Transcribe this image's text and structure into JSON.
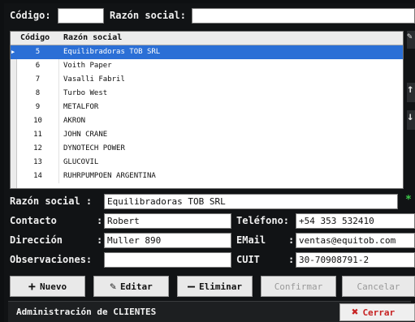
{
  "search": {
    "codigo_label": "Código:",
    "codigo_value": "",
    "razon_label": "Razón social:",
    "razon_value": ""
  },
  "grid": {
    "columns": [
      "Código",
      "Razón social"
    ],
    "rows": [
      {
        "code": "5",
        "name": "Equilibradoras TOB SRL",
        "selected": true
      },
      {
        "code": "6",
        "name": "Voith Paper"
      },
      {
        "code": "7",
        "name": "Vasalli Fabril"
      },
      {
        "code": "8",
        "name": "Turbo West"
      },
      {
        "code": "9",
        "name": "METALFOR"
      },
      {
        "code": "10",
        "name": "AKRON"
      },
      {
        "code": "11",
        "name": "JOHN CRANE"
      },
      {
        "code": "12",
        "name": "DYNOTECH POWER"
      },
      {
        "code": "13",
        "name": "GLUCOVIL"
      },
      {
        "code": "14",
        "name": "RUHRPUMPOEN ARGENTINA"
      }
    ]
  },
  "form": {
    "razon_label": "Razón social :",
    "razon_value": "Equilibradoras TOB SRL",
    "contacto_label": "Contacto",
    "contacto_value": "Robert",
    "telefono_label": "Teléfono:",
    "telefono_value": "+54 353 532410",
    "direccion_label": "Dirección",
    "direccion_value": "Muller 890",
    "email_label": "EMail",
    "email_value": "ventas@equitob.com",
    "obs_label": "Observaciones:",
    "obs_value": "",
    "cuit_label": "CUIT",
    "cuit_value": "30-70908791-2",
    "colon": ":"
  },
  "toolbar": {
    "nuevo": "Nuevo",
    "editar": "Editar",
    "eliminar": "Eliminar",
    "confirmar": "Confirmar",
    "cancelar": "Cancelar"
  },
  "status": {
    "title": "Administración de CLIENTES",
    "close": "Cerrar"
  },
  "colors": {
    "selection": "#2b6fd6",
    "close_icon": "#c72222",
    "required_marker": "#3cc84a"
  },
  "icons": {
    "nuevo": "plus-icon",
    "editar": "pencil-icon",
    "eliminar": "minus-icon",
    "close": "x-icon",
    "side_up": "arrow-up-icon",
    "side_down": "arrow-down-icon"
  }
}
